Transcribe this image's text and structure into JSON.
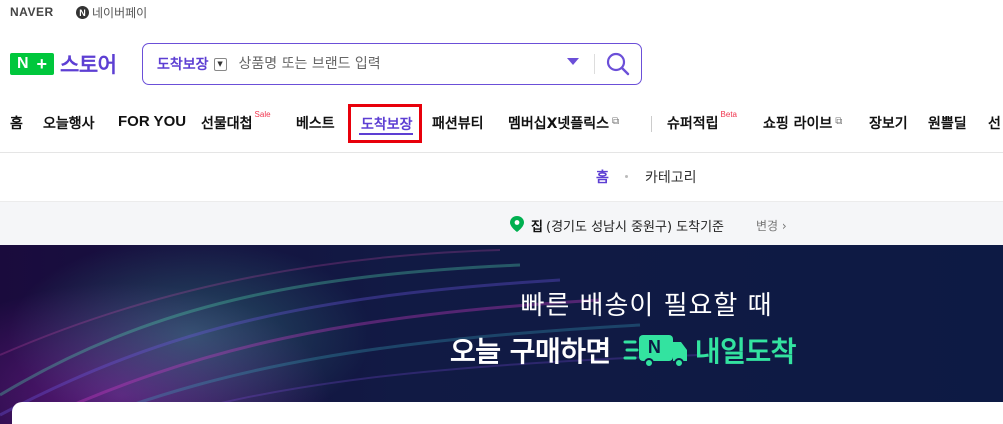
{
  "top": {
    "naver": "NAVER",
    "npay_icon": "N",
    "npay": "네이버페이"
  },
  "logo": {
    "badge_n": "N",
    "badge_plus": "+",
    "text": "스토어"
  },
  "search": {
    "category": "도착보장",
    "placeholder": "상품명 또는 브랜드 입력",
    "icons": [
      "dropdown-caret-icon",
      "search-icon"
    ]
  },
  "nav": {
    "items": [
      {
        "label": "홈"
      },
      {
        "label": "오늘행사"
      },
      {
        "label": "FOR YOU"
      },
      {
        "label": "선물대첩",
        "badge": "Sale"
      },
      {
        "label": "베스트"
      },
      {
        "label": "도착보장",
        "active": true
      },
      {
        "label": "패션뷰티"
      },
      {
        "label": "멤버십X넷플릭스",
        "ext": "⧉"
      },
      {
        "label": "슈퍼적립",
        "badge": "Beta"
      },
      {
        "label": "쇼핑 라이브",
        "ext": "⧉"
      },
      {
        "label": "장보기"
      },
      {
        "label": "원쁠딜"
      },
      {
        "label": "선"
      }
    ]
  },
  "subnav": {
    "home": "홈",
    "category": "카테고리"
  },
  "location": {
    "home": "집",
    "address": "(경기도 성남시 중원구) 도착기준",
    "change": "변경"
  },
  "banner": {
    "line1": "빠른 배송이 필요할 때",
    "line2_prefix": "오늘 구매하면",
    "truck_letter": "N",
    "line2_highlight": "내일도착"
  },
  "colors": {
    "brand_purple": "#5d3fd3",
    "naver_green": "#00c73c",
    "highlight_red": "#e8000b",
    "banner_green": "#33e3a0"
  }
}
